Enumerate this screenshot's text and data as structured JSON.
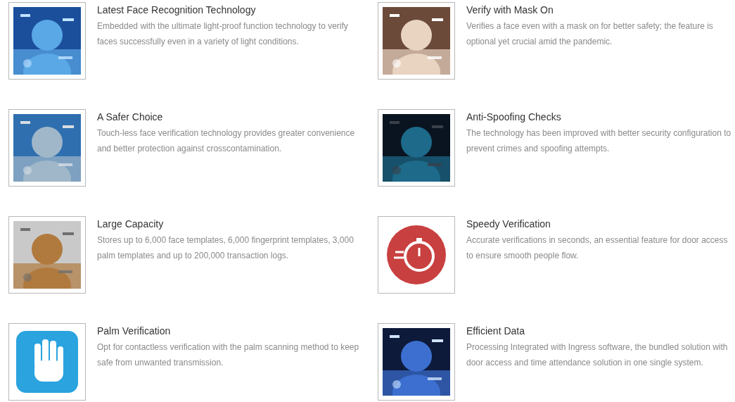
{
  "features": [
    {
      "title": "Latest Face Recognition Technology",
      "description": "Embedded with the ultimate light-proof function technology to verify faces successfully even in a variety of light conditions."
    },
    {
      "title": "Verify with Mask On",
      "description": "Verifies a face even with a mask on for better safety; the feature is optional yet crucial amid the pandemic."
    },
    {
      "title": "A Safer Choice",
      "description": "Touch-less face verification technology provides greater convenience and better protection against crosscontamination."
    },
    {
      "title": "Anti-Spoofing Checks",
      "description": "The technology has been improved with better security configuration to prevent crimes and spoofing attempts."
    },
    {
      "title": "Large Capacity",
      "description": "Stores up to 6,000 face templates, 6,000 fingerprint templates, 3,000 palm templates and up to 200,000 transaction logs."
    },
    {
      "title": "Speedy Verification",
      "description": "Accurate verifications in seconds, an essential feature for door access to ensure smooth people flow."
    },
    {
      "title": "Palm Verification",
      "description": "Opt for contactless verification with the palm scanning method to keep safe from unwanted transmission."
    },
    {
      "title": "Efficient Data",
      "description": "Processing Integrated with Ingress software, the bundled solution with door access and time attendance solution in one single system."
    }
  ]
}
